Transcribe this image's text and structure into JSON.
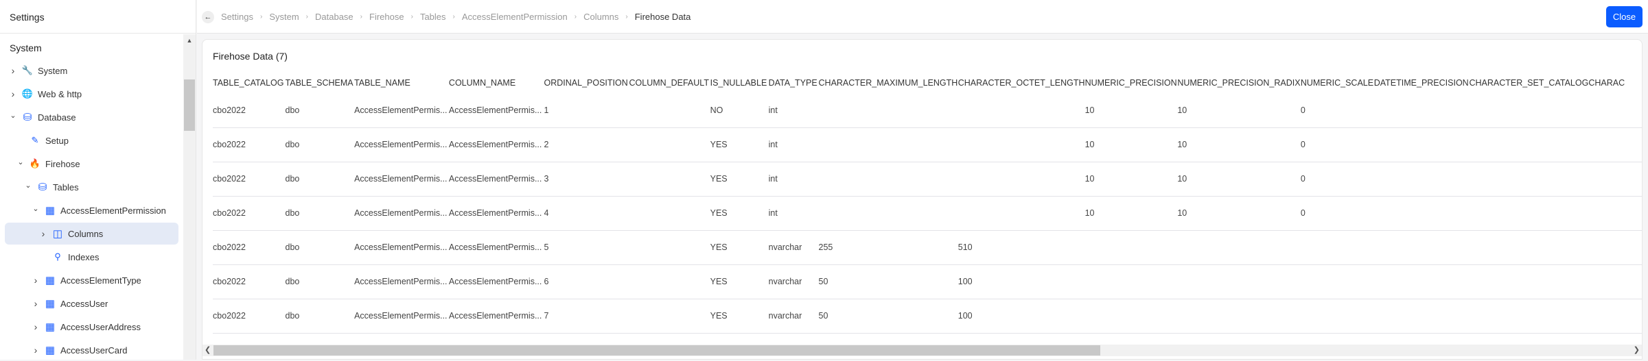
{
  "sidebar": {
    "title": "Settings",
    "section": "System",
    "items": [
      {
        "label": "System",
        "icon": "wrench-icon",
        "chevron": "right"
      },
      {
        "label": "Web & http",
        "icon": "globe-icon",
        "chevron": "right"
      },
      {
        "label": "Database",
        "icon": "database-icon",
        "chevron": "down"
      },
      {
        "label": "Setup",
        "icon": "edit-icon",
        "chevron": ""
      },
      {
        "label": "Firehose",
        "icon": "fire-icon",
        "chevron": "down"
      },
      {
        "label": "Tables",
        "icon": "database-icon",
        "chevron": "down"
      },
      {
        "label": "AccessElementPermission",
        "icon": "table-icon",
        "chevron": "down"
      },
      {
        "label": "Columns",
        "icon": "columns-icon",
        "chevron": "right",
        "selected": true
      },
      {
        "label": "Indexes",
        "icon": "search-icon",
        "chevron": ""
      },
      {
        "label": "AccessElementType",
        "icon": "table-icon",
        "chevron": "right"
      },
      {
        "label": "AccessUser",
        "icon": "table-icon",
        "chevron": "right"
      },
      {
        "label": "AccessUserAddress",
        "icon": "table-icon",
        "chevron": "right"
      },
      {
        "label": "AccessUserCard",
        "icon": "table-icon",
        "chevron": "right"
      }
    ]
  },
  "breadcrumb": [
    "Settings",
    "System",
    "Database",
    "Firehose",
    "Tables",
    "AccessElementPermission",
    "Columns",
    "Firehose Data"
  ],
  "close_label": "Close",
  "accent": "#0b5cff",
  "card": {
    "title": "Firehose Data (7)",
    "columns": [
      "TABLE_CATALOG",
      "TABLE_SCHEMA",
      "TABLE_NAME",
      "COLUMN_NAME",
      "ORDINAL_POSITION",
      "COLUMN_DEFAULT",
      "IS_NULLABLE",
      "DATA_TYPE",
      "CHARACTER_MAXIMUM_LENGTH",
      "CHARACTER_OCTET_LENGTH",
      "NUMERIC_PRECISION",
      "NUMERIC_PRECISION_RADIX",
      "NUMERIC_SCALE",
      "DATETIME_PRECISION",
      "CHARACTER_SET_CATALOG",
      "CHARAC"
    ],
    "rows": [
      [
        "cbo2022",
        "dbo",
        "AccessElementPermis...",
        "AccessElementPermis...",
        "1",
        "",
        "NO",
        "int",
        "",
        "",
        "10",
        "10",
        "0",
        "",
        "",
        ""
      ],
      [
        "cbo2022",
        "dbo",
        "AccessElementPermis...",
        "AccessElementPermis...",
        "2",
        "",
        "YES",
        "int",
        "",
        "",
        "10",
        "10",
        "0",
        "",
        "",
        ""
      ],
      [
        "cbo2022",
        "dbo",
        "AccessElementPermis...",
        "AccessElementPermis...",
        "3",
        "",
        "YES",
        "int",
        "",
        "",
        "10",
        "10",
        "0",
        "",
        "",
        ""
      ],
      [
        "cbo2022",
        "dbo",
        "AccessElementPermis...",
        "AccessElementPermis...",
        "4",
        "",
        "YES",
        "int",
        "",
        "",
        "10",
        "10",
        "0",
        "",
        "",
        ""
      ],
      [
        "cbo2022",
        "dbo",
        "AccessElementPermis...",
        "AccessElementPermis...",
        "5",
        "",
        "YES",
        "nvarchar",
        "255",
        "510",
        "",
        "",
        "",
        "",
        "",
        ""
      ],
      [
        "cbo2022",
        "dbo",
        "AccessElementPermis...",
        "AccessElementPermis...",
        "6",
        "",
        "YES",
        "nvarchar",
        "50",
        "100",
        "",
        "",
        "",
        "",
        "",
        ""
      ],
      [
        "cbo2022",
        "dbo",
        "AccessElementPermis...",
        "AccessElementPermis...",
        "7",
        "",
        "YES",
        "nvarchar",
        "50",
        "100",
        "",
        "",
        "",
        "",
        "",
        ""
      ]
    ]
  }
}
